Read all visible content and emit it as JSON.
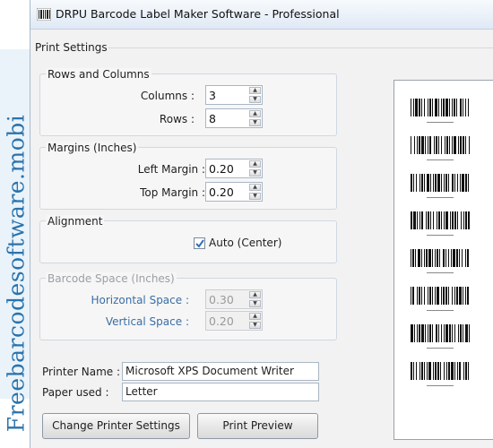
{
  "watermark": "Freebarcodesoftware.mobi",
  "window": {
    "title": "DRPU Barcode Label Maker Software - Professional"
  },
  "print_settings": {
    "label": "Print Settings"
  },
  "rows_columns": {
    "title": "Rows and Columns",
    "columns_label": "Columns :",
    "columns_value": "3",
    "rows_label": "Rows :",
    "rows_value": "8"
  },
  "margins": {
    "title": "Margins (Inches)",
    "left_label": "Left Margin :",
    "left_value": "0.20",
    "top_label": "Top Margin :",
    "top_value": "0.20"
  },
  "alignment": {
    "title": "Alignment",
    "auto_label": "Auto (Center)",
    "auto_checked": true
  },
  "barcode_space": {
    "title": "Barcode Space (Inches)",
    "horizontal_label": "Horizontal Space :",
    "horizontal_value": "0.30",
    "vertical_label": "Vertical Space :",
    "vertical_value": "0.20"
  },
  "printer": {
    "name_label": "Printer Name :",
    "name_value": "Microsoft XPS Document Writer",
    "paper_label": "Paper used :",
    "paper_value": "Letter"
  },
  "buttons": {
    "change_printer": "Change Printer Settings",
    "print_preview": "Print Preview"
  },
  "preview": {
    "barcode_count": 8
  },
  "colors": {
    "watermark": "#2a73ad",
    "disabled_label": "#3a6ea5",
    "check": "#2f6fb4"
  }
}
